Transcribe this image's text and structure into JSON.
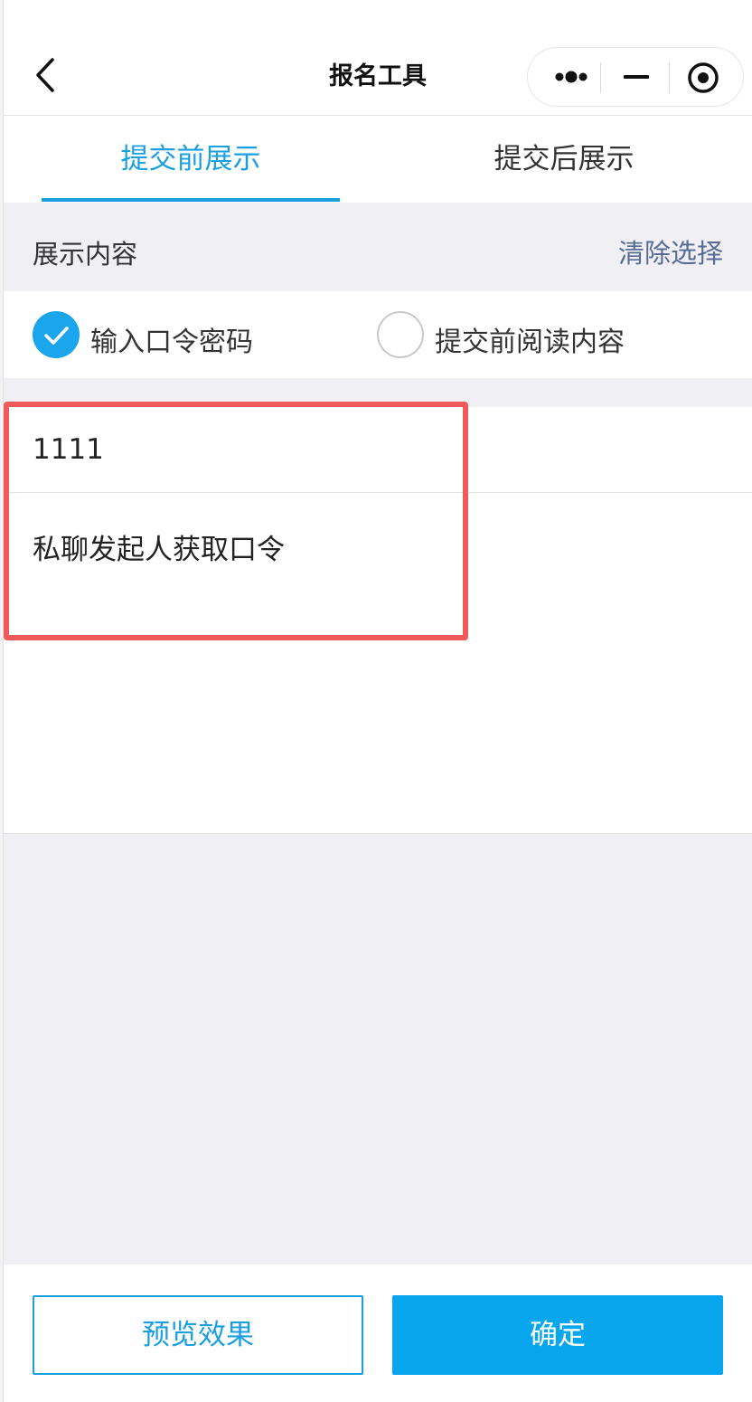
{
  "navbar": {
    "title": "报名工具",
    "back_icon": "chevron-left-icon",
    "capsule": {
      "more_icon": "more-dots-icon",
      "minimize_icon": "minimize-icon",
      "close_icon": "target-close-icon"
    }
  },
  "tabs": [
    {
      "label": "提交前展示",
      "active": true
    },
    {
      "label": "提交后展示",
      "active": false
    }
  ],
  "section": {
    "title": "展示内容",
    "clear_label": "清除选择"
  },
  "options": [
    {
      "label": "输入口令密码",
      "checked": true
    },
    {
      "label": "提交前阅读内容",
      "checked": false
    }
  ],
  "form": {
    "password_value": "1111",
    "hint_value": "私聊发起人获取口令"
  },
  "footer": {
    "preview_label": "预览效果",
    "confirm_label": "确定"
  },
  "colors": {
    "accent": "#1a9fe0",
    "confirm_bg": "#08a6ec",
    "link": "#576b95",
    "highlight": "#f05a5b",
    "page_bg": "#efeff4"
  }
}
